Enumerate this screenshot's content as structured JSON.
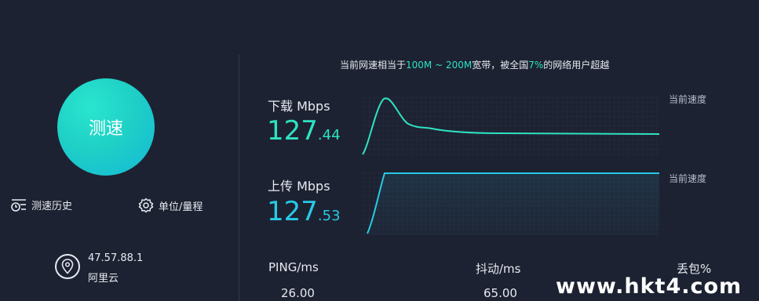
{
  "left_panel": {
    "test_button_label": "测速",
    "history_label": "测速历史",
    "units_label": "单位/量程",
    "server_ip": "47.57.88.1",
    "server_name": "阿里云"
  },
  "message": {
    "part1": "当前网速相当于",
    "range": "100M ~ 200M",
    "part2": "宽带，被全国",
    "percent": "7%",
    "part3": "的网络用户超越"
  },
  "download": {
    "label": "下载 Mbps",
    "value_int": "127",
    "value_frac": ".44",
    "current_label": "当前速度"
  },
  "upload": {
    "label": "上传 Mbps",
    "value_int": "127",
    "value_frac": ".53",
    "current_label": "当前速度"
  },
  "stats": {
    "ping_label": "PING/ms",
    "ping_value": "26.00",
    "jitter_label": "抖动/ms",
    "jitter_value": "65.00",
    "loss_label": "丢包%"
  },
  "watermark": "www.hkt4.com",
  "colors": {
    "background": "#1d2232",
    "download_accent": "#2ee3c2",
    "upload_accent": "#27cbe6"
  },
  "icons": {
    "history": "history-list-icon",
    "units": "gear-icon",
    "server": "location-pin-icon"
  }
}
